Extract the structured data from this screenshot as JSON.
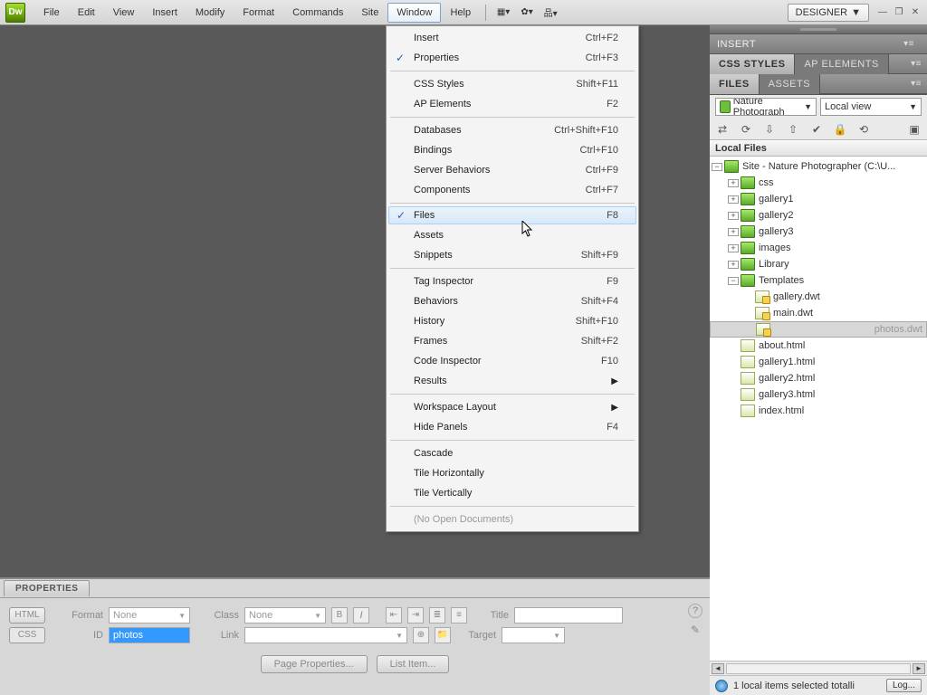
{
  "menubar": {
    "items": [
      "File",
      "Edit",
      "View",
      "Insert",
      "Modify",
      "Format",
      "Commands",
      "Site",
      "Window",
      "Help"
    ],
    "active_index": 8,
    "workspace_label": "DESIGNER",
    "workspace_arrow": "▼"
  },
  "dropdown": {
    "groups": [
      [
        {
          "label": "Insert",
          "shortcut": "Ctrl+F2",
          "checked": false
        },
        {
          "label": "Properties",
          "shortcut": "Ctrl+F3",
          "checked": true
        }
      ],
      [
        {
          "label": "CSS Styles",
          "shortcut": "Shift+F11"
        },
        {
          "label": "AP Elements",
          "shortcut": "F2"
        }
      ],
      [
        {
          "label": "Databases",
          "shortcut": "Ctrl+Shift+F10"
        },
        {
          "label": "Bindings",
          "shortcut": "Ctrl+F10"
        },
        {
          "label": "Server Behaviors",
          "shortcut": "Ctrl+F9"
        },
        {
          "label": "Components",
          "shortcut": "Ctrl+F7"
        }
      ],
      [
        {
          "label": "Files",
          "shortcut": "F8",
          "checked": true,
          "highlight": true
        },
        {
          "label": "Assets",
          "shortcut": ""
        },
        {
          "label": "Snippets",
          "shortcut": "Shift+F9"
        }
      ],
      [
        {
          "label": "Tag Inspector",
          "shortcut": "F9"
        },
        {
          "label": "Behaviors",
          "shortcut": "Shift+F4"
        },
        {
          "label": "History",
          "shortcut": "Shift+F10"
        },
        {
          "label": "Frames",
          "shortcut": "Shift+F2"
        },
        {
          "label": "Code Inspector",
          "shortcut": "F10"
        },
        {
          "label": "Results",
          "submenu": true
        }
      ],
      [
        {
          "label": "Workspace Layout",
          "submenu": true
        },
        {
          "label": "Hide Panels",
          "shortcut": "F4"
        }
      ],
      [
        {
          "label": "Cascade"
        },
        {
          "label": "Tile Horizontally"
        },
        {
          "label": "Tile Vertically"
        }
      ],
      [
        {
          "label": "(No Open Documents)",
          "disabled": true
        }
      ]
    ]
  },
  "panels": {
    "insert_label": "INSERT",
    "css_label": "CSS STYLES",
    "ap_label": "AP ELEMENTS",
    "files_label": "FILES",
    "assets_label": "ASSETS"
  },
  "files": {
    "site_combo": "Nature Photograph",
    "view_combo": "Local view",
    "header": "Local Files",
    "root": "Site - Nature Photographer (C:\\U...",
    "folders": [
      "css",
      "gallery1",
      "gallery2",
      "gallery3",
      "images",
      "Library",
      "Templates"
    ],
    "templates": [
      "gallery.dwt",
      "main.dwt",
      "photos.dwt"
    ],
    "templates_selected": "photos.dwt",
    "html_files": [
      "about.html",
      "gallery1.html",
      "gallery2.html",
      "gallery3.html",
      "index.html"
    ],
    "status": "1 local items selected totalli",
    "log_label": "Log..."
  },
  "properties": {
    "tab": "PROPERTIES",
    "mode_html": "HTML",
    "mode_css": "CSS",
    "format_label": "Format",
    "format_value": "None",
    "id_label": "ID",
    "id_value": "photos",
    "class_label": "Class",
    "class_value": "None",
    "link_label": "Link",
    "title_label": "Title",
    "target_label": "Target",
    "btn_page": "Page Properties...",
    "btn_list": "List Item..."
  }
}
